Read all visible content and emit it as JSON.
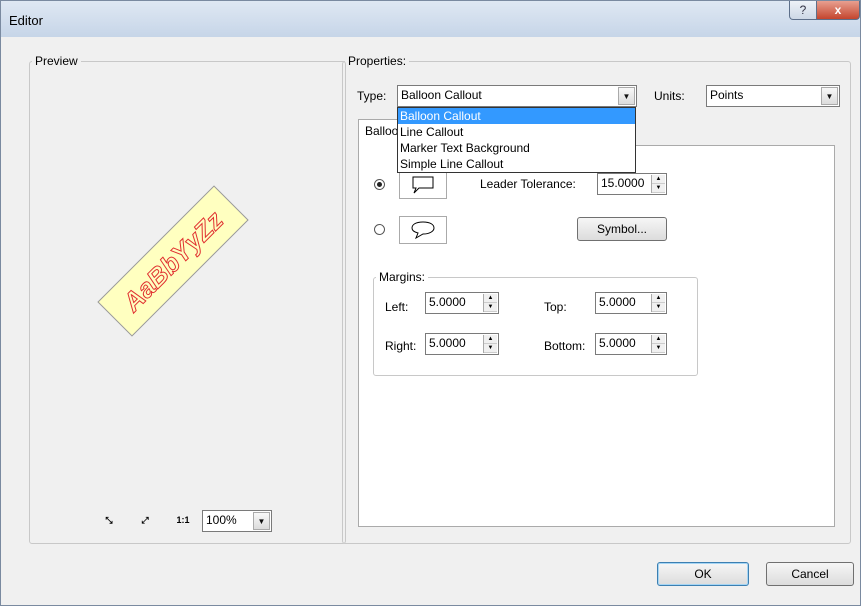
{
  "window": {
    "title": "Editor",
    "help_label": "?",
    "close_label": "x"
  },
  "preview": {
    "legend": "Preview",
    "sample_text": "AaBbYyZz",
    "zoom_value": "100%",
    "tools": [
      "zoom-to-fit-icon",
      "zoom-to-extent-icon",
      "actual-size-icon"
    ]
  },
  "properties": {
    "legend": "Properties:",
    "type_label": "Type:",
    "type_value": "Balloon Callout",
    "type_options": [
      "Balloon Callout",
      "Line Callout",
      "Marker Text Background",
      "Simple Line Callout"
    ],
    "units_label": "Units:",
    "units_value": "Points",
    "tab_label": "Balloon Callout",
    "leader_tolerance_label": "Leader Tolerance:",
    "leader_tolerance_value": "15.0000",
    "symbol_button": "Symbol...",
    "callout_style_selected": "rectangle-callout"
  },
  "margins": {
    "legend": "Margins:",
    "left_label": "Left:",
    "left_value": "5.0000",
    "top_label": "Top:",
    "top_value": "5.0000",
    "right_label": "Right:",
    "right_value": "5.0000",
    "bottom_label": "Bottom:",
    "bottom_value": "5.0000"
  },
  "buttons": {
    "ok": "OK",
    "cancel": "Cancel"
  },
  "colors": {
    "selection": "#3399ff",
    "sample_fill": "#ffffc0",
    "sample_text": "#e03030"
  }
}
